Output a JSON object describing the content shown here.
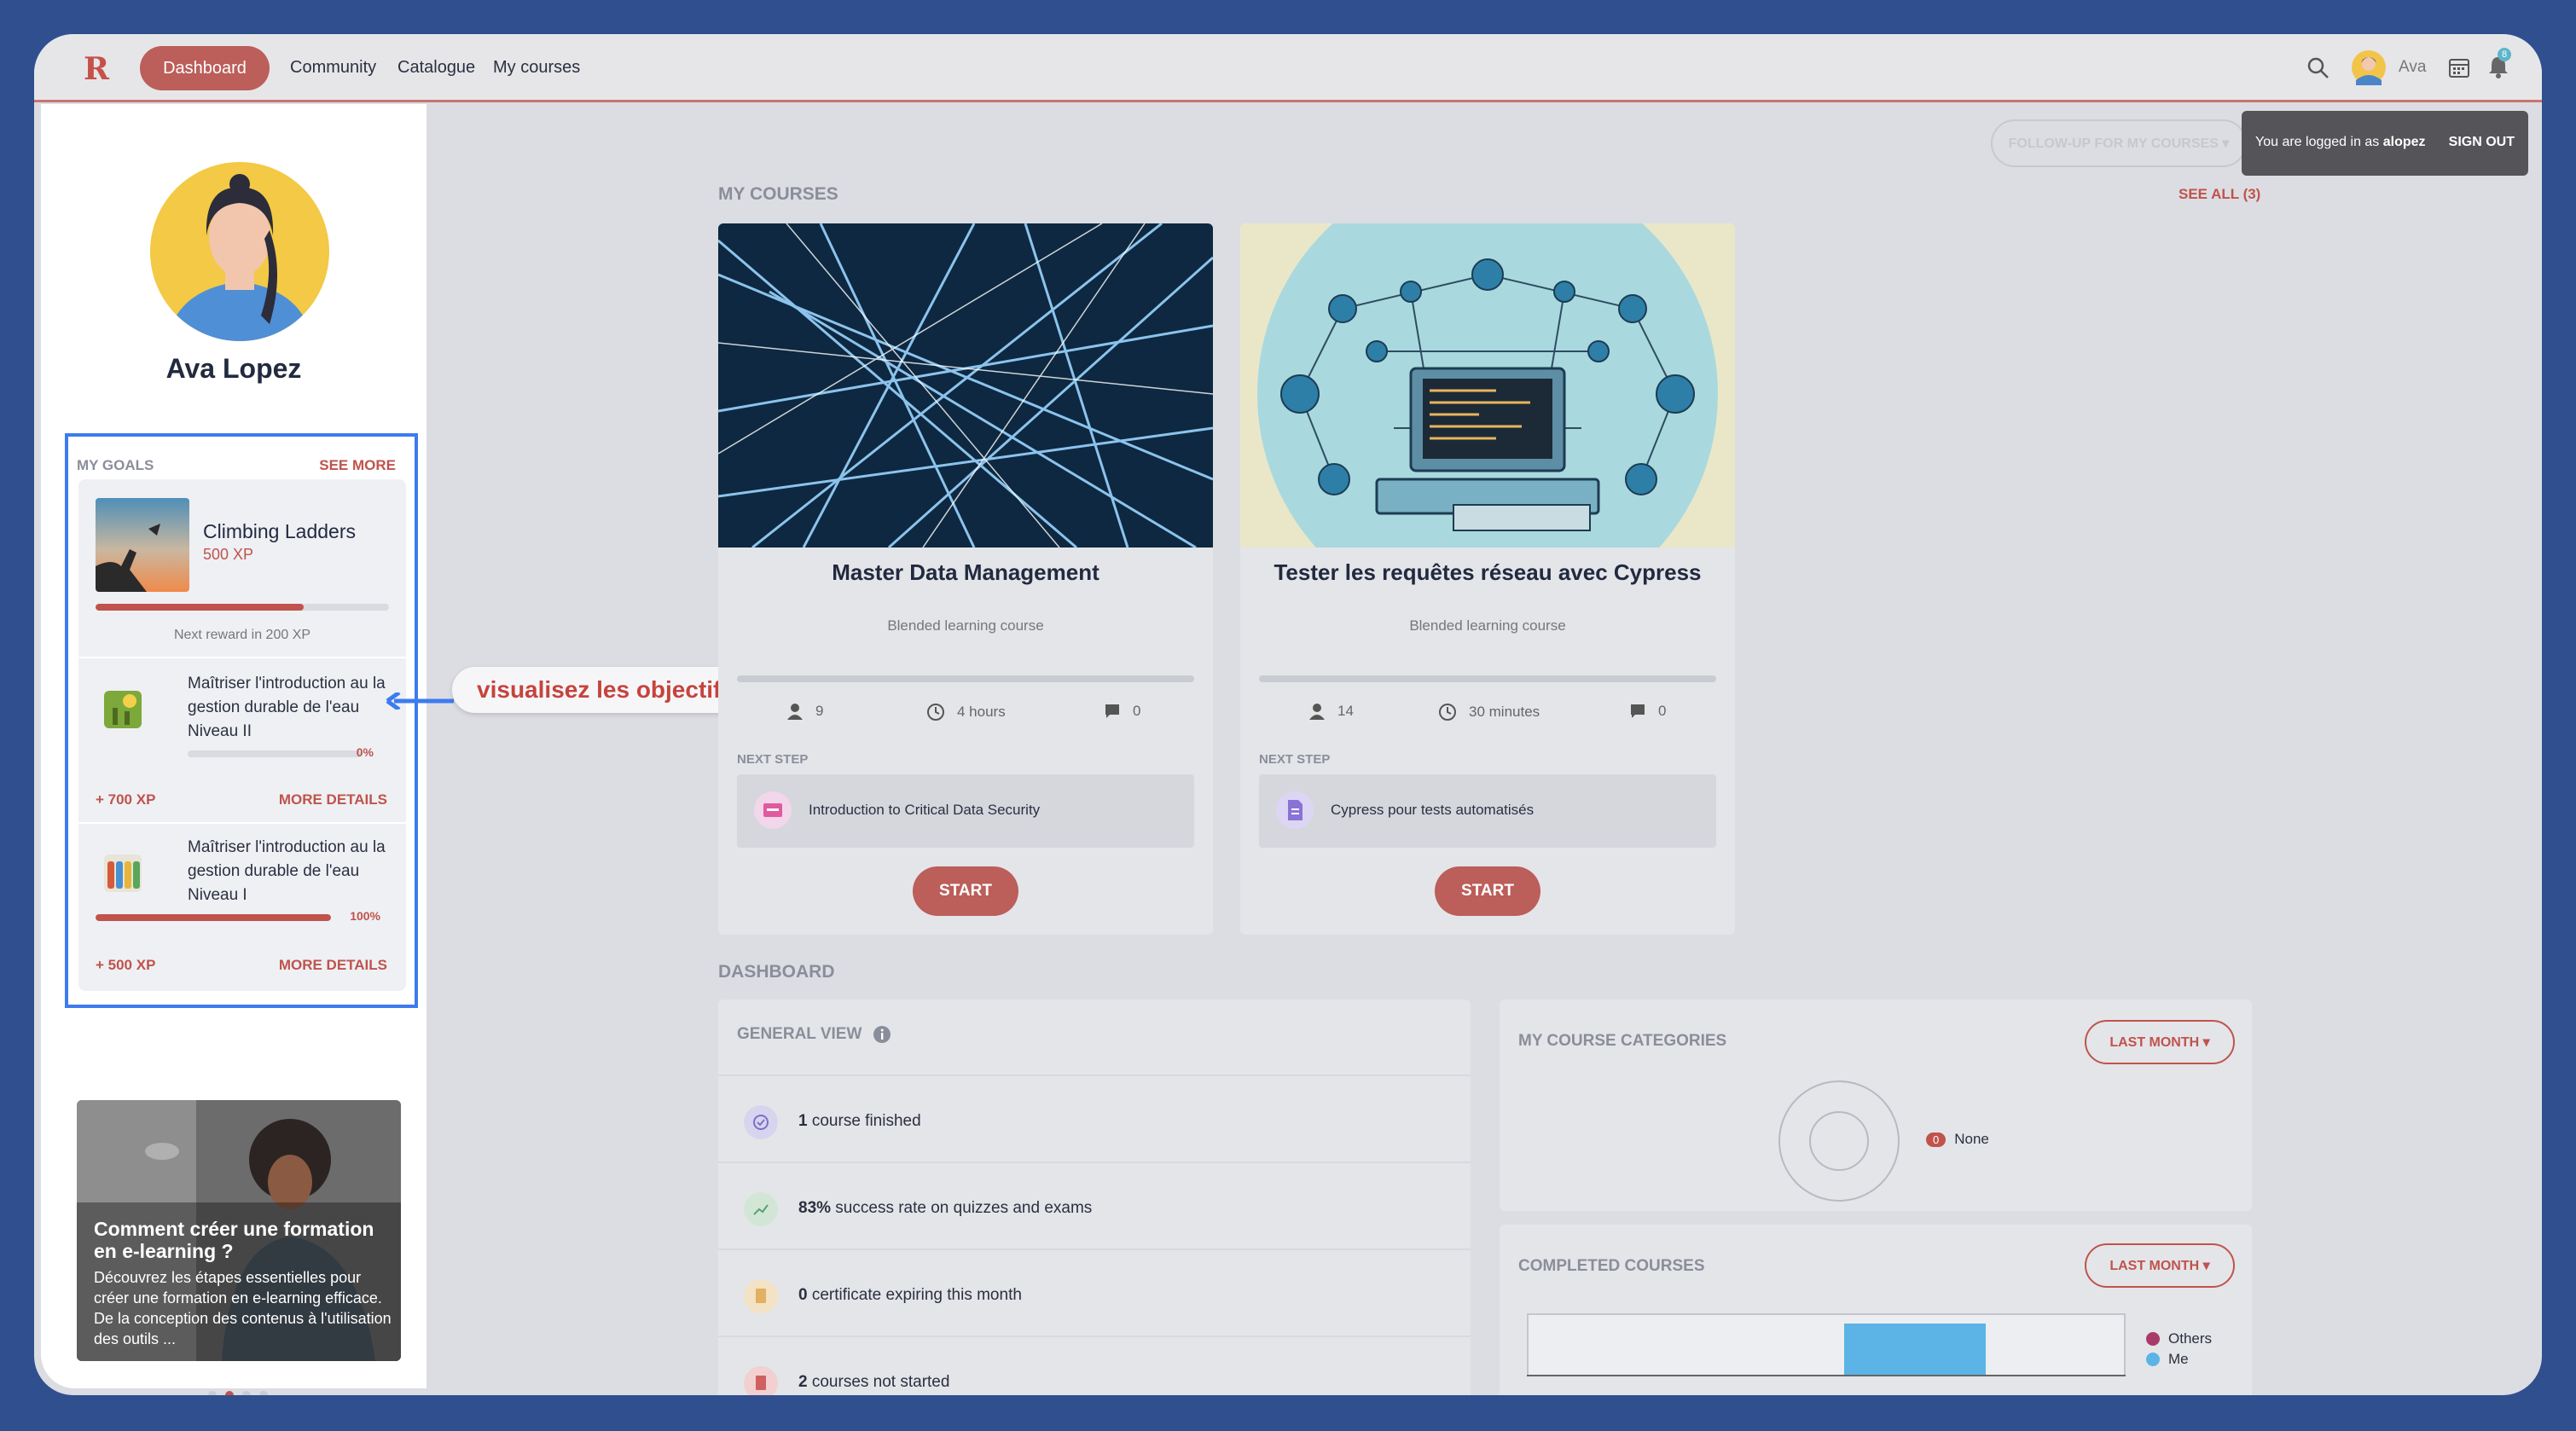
{
  "colors": {
    "accent": "#bc5e59",
    "highlight_box": "#3d7bf0",
    "chart_me": "#5bb4e5",
    "chart_others": "#a93b6a"
  },
  "nav": {
    "logo": "R",
    "items": [
      "Dashboard",
      "Community",
      "Catalogue",
      "My courses"
    ],
    "active": "Dashboard",
    "user_name": "Ava",
    "notification_count": "8"
  },
  "profile": {
    "name": "Ava Lopez"
  },
  "goals": {
    "title": "MY GOALS",
    "see_more": "SEE MORE",
    "main": {
      "name": "Climbing Ladders",
      "xp": "500 XP",
      "progress": 0.71,
      "next_reward": "Next reward in 200 XP"
    },
    "items": [
      {
        "text": "Maîtriser l'introduction au la gestion durable de l'eau Niveau II",
        "percent_label": "0%",
        "progress": 0,
        "xp": "+ 700 XP",
        "more": "MORE DETAILS"
      },
      {
        "text": "Maîtriser l'introduction au la gestion durable de l'eau Niveau I",
        "percent_label": "100%",
        "progress": 1,
        "xp": "+ 500 XP",
        "more": "MORE DETAILS"
      }
    ]
  },
  "article": {
    "title": "Comment créer une formation en e-learning ?",
    "desc": "Découvrez les étapes essentielles pour créer une formation en e-learning efficace. De la conception des contenus à l'utilisation des outils ..."
  },
  "callout": "visualisez les objectifs",
  "top": {
    "follow_up": "FOLLOW-UP FOR MY COURSES ▾",
    "logged_prefix": "You are logged in as ",
    "logged_user": "alopez",
    "sign_out": "SIGN OUT"
  },
  "my_courses": {
    "title": "MY COURSES",
    "see_all": "SEE ALL (3)",
    "cards": [
      {
        "title": "Master Data Management",
        "type": "Blended learning course",
        "learners": "9",
        "duration": "4 hours",
        "comments": "0",
        "next_step_label": "NEXT STEP",
        "next_step": "Introduction to Critical Data Security",
        "start": "START"
      },
      {
        "title": "Tester les requêtes réseau avec Cypress",
        "type": "Blended learning course",
        "learners": "14",
        "duration": "30 minutes",
        "comments": "0",
        "next_step_label": "NEXT STEP",
        "next_step": "Cypress pour tests automatisés",
        "start": "START"
      }
    ]
  },
  "dashboard": {
    "title": "DASHBOARD",
    "general_view": {
      "title": "GENERAL VIEW",
      "rows": [
        {
          "value": "1",
          "label": " course finished"
        },
        {
          "value": "83%",
          "label": " success rate on quizzes and exams"
        },
        {
          "value": "0",
          "label": " certificate expiring this month"
        },
        {
          "value": "2",
          "label": " courses not started"
        }
      ]
    },
    "categories": {
      "title": "MY COURSE CATEGORIES",
      "filter": "LAST MONTH ▾",
      "badge": "0",
      "label": "None"
    },
    "completed": {
      "title": "COMPLETED COURSES",
      "filter": "LAST MONTH ▾",
      "legend": [
        "Others",
        "Me"
      ]
    }
  }
}
